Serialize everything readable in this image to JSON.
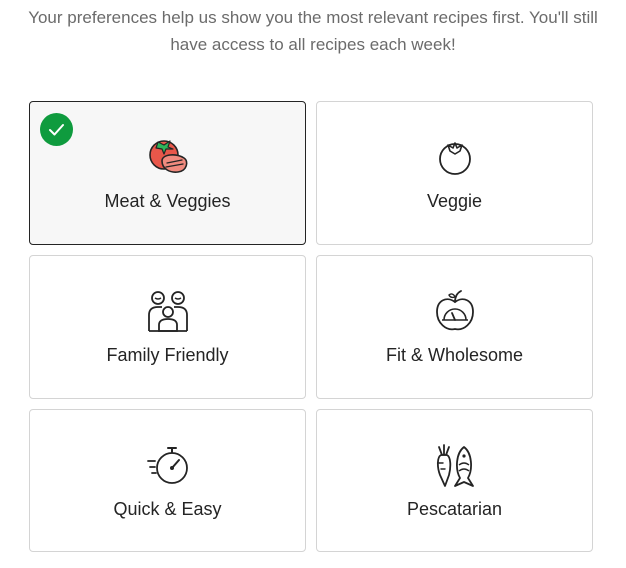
{
  "intro": {
    "line1": "Your preferences help us show you the most relevant recipes first. You'll still",
    "line2": "have access to all recipes each week!"
  },
  "preferences": [
    {
      "label": "Meat & Veggies",
      "icon": "steak-tomato-icon",
      "selected": true
    },
    {
      "label": "Veggie",
      "icon": "tomato-icon",
      "selected": false
    },
    {
      "label": "Family Friendly",
      "icon": "family-icon",
      "selected": false
    },
    {
      "label": "Fit & Wholesome",
      "icon": "apple-scale-icon",
      "selected": false
    },
    {
      "label": "Quick & Easy",
      "icon": "stopwatch-icon",
      "selected": false
    },
    {
      "label": "Pescatarian",
      "icon": "carrot-fish-icon",
      "selected": false
    }
  ],
  "colors": {
    "accent_green": "#0f9b3e",
    "tomato_red": "#e8574a",
    "selected_border": "#242424",
    "card_border": "#d4d4d4",
    "intro_text": "#6b6b6b"
  }
}
